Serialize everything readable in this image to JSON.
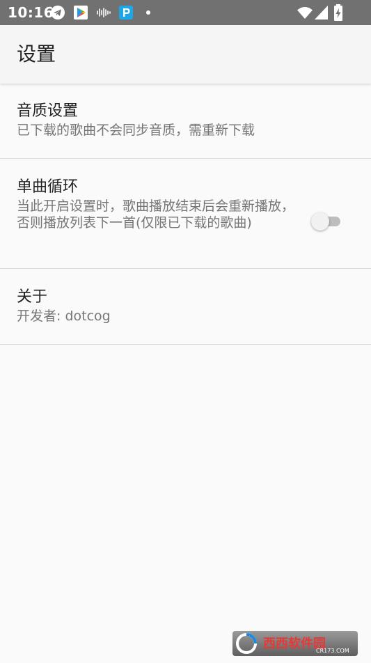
{
  "status_bar": {
    "time": "10:16",
    "icons": [
      "telegram-icon",
      "play-store-icon",
      "audio-waveform-icon",
      "p-app-icon",
      "wifi-icon",
      "signal-icon",
      "battery-charging-icon"
    ]
  },
  "app_bar": {
    "title": "设置"
  },
  "preferences": {
    "audio_quality": {
      "title": "音质设置",
      "summary": "已下载的歌曲不会同步音质，需重新下载"
    },
    "single_loop": {
      "title": "单曲循环",
      "summary": "当此开启设置时，歌曲播放结束后会重新播放，否则播放列表下一首(仅限已下载的歌曲)",
      "enabled": false
    },
    "about": {
      "title": "关于",
      "summary": "开发者: dotcog"
    }
  },
  "watermark": {
    "text": "西西软件园",
    "subtext": "CR173.COM"
  },
  "colors": {
    "status_bar": "#717171",
    "app_bar": "#f5f5f5",
    "background": "#fafafa",
    "title_text": "#212121",
    "summary_text": "#757575"
  }
}
